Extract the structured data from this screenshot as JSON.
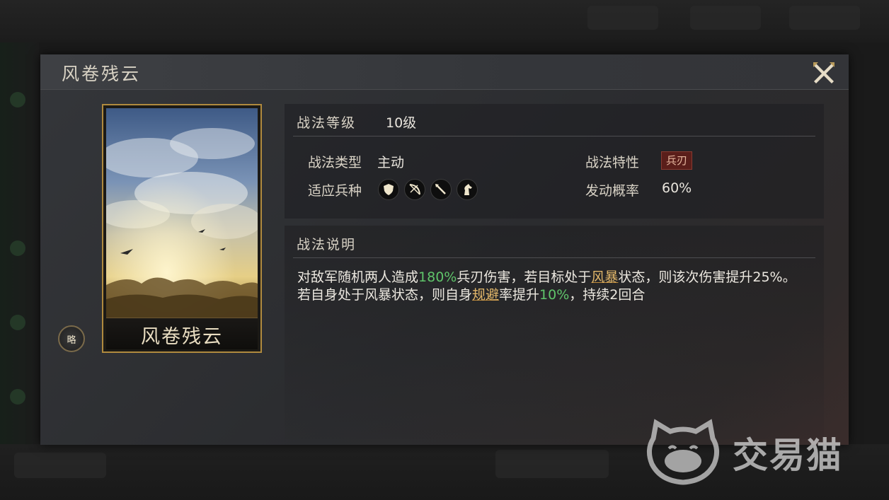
{
  "dialog": {
    "title": "风卷残云"
  },
  "card": {
    "name": "风卷残云",
    "strategy_badge": "略"
  },
  "skill": {
    "level_label": "战法等级",
    "level_value": "10级",
    "type_label": "战法类型",
    "type_value": "主动",
    "trait_label": "战法特性",
    "trait_value": "兵刃",
    "troops_label": "适应兵种",
    "troops": [
      "shield-icon",
      "bow-icon",
      "spear-icon",
      "horse-icon"
    ],
    "chance_label": "发动概率",
    "chance_value": "60%"
  },
  "description": {
    "header": "战法说明",
    "l1_a": "对敌军随机两人造成",
    "l1_b": "180%",
    "l1_c": "兵刃伤害，若目标处于",
    "l1_d": "风暴",
    "l1_e": "状态，则该次伤害提升25%。",
    "l2_a": "若自身处于风暴状态，则自身",
    "l2_b": "规避",
    "l2_c": "率提升",
    "l2_d": "10%",
    "l2_e": "，持续2回合"
  },
  "watermark": {
    "text": "交易猫"
  },
  "colors": {
    "highlight_green": "#5fc46a",
    "highlight_gold": "#e2b76a",
    "trait_red": "#5a1e1a",
    "card_border": "#b08a3e"
  }
}
